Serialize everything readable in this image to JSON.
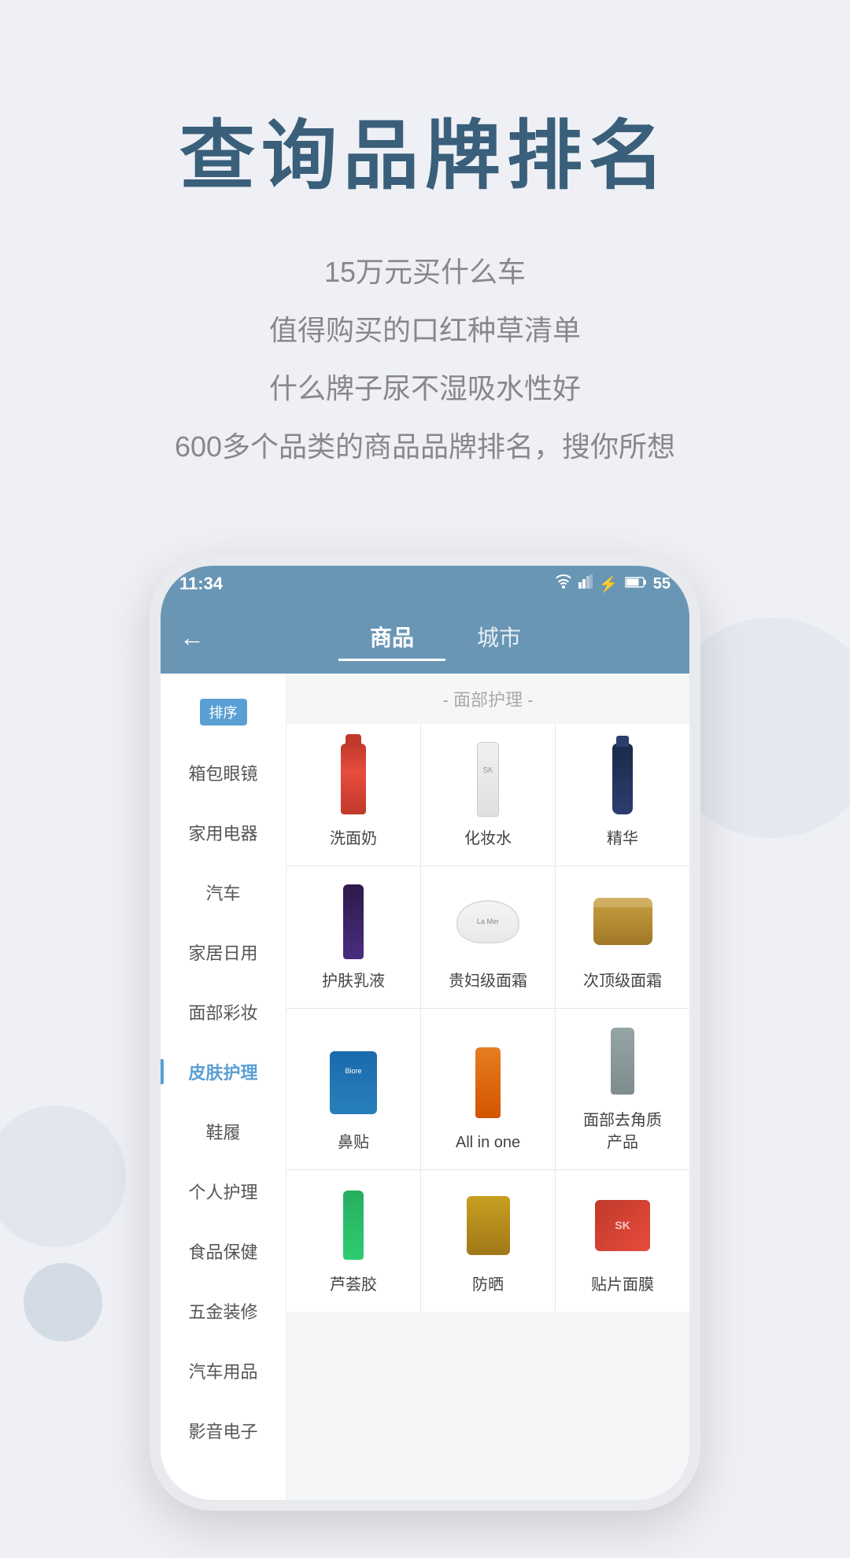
{
  "page": {
    "background": "#eef0f5"
  },
  "hero": {
    "title": "查询品牌排名",
    "subtitles": [
      "15万元买什么车",
      "值得购买的口红种草清单",
      "什么牌子尿不湿吸水性好",
      "600多个品类的商品品牌排名，搜你所想"
    ]
  },
  "phone": {
    "status": {
      "time": "11:34",
      "battery": "55"
    },
    "nav": {
      "back_label": "←",
      "tab1": "商品",
      "tab2": "城市"
    },
    "sidebar": {
      "badge_label": "排序",
      "items": [
        "箱包眼镜",
        "家用电器",
        "汽车",
        "家居日用",
        "面部彩妆",
        "皮肤护理",
        "鞋履",
        "个人护理",
        "食品保健",
        "五金装修",
        "汽车用品",
        "影音电子"
      ],
      "active_item": "皮肤护理"
    },
    "section_header": "- 面部护理 -",
    "products": [
      {
        "label": "洗面奶",
        "image_type": "face-wash"
      },
      {
        "label": "化妆水",
        "image_type": "toner"
      },
      {
        "label": "精华",
        "image_type": "serum"
      },
      {
        "label": "护肤乳液",
        "image_type": "lotion"
      },
      {
        "label": "贵妇级面霜",
        "image_type": "lamer"
      },
      {
        "label": "次顶级面霜",
        "image_type": "gold-cream"
      },
      {
        "label": "鼻贴",
        "image_type": "nose-patch"
      },
      {
        "label": "All in one",
        "image_type": "all-in-one"
      },
      {
        "label": "面部去角质\n产品",
        "image_type": "exfoliant"
      },
      {
        "label": "芦荟胶",
        "image_type": "aloe"
      },
      {
        "label": "防晒",
        "image_type": "sunscreen"
      },
      {
        "label": "贴片面膜",
        "image_type": "sheet-mask"
      }
    ]
  }
}
